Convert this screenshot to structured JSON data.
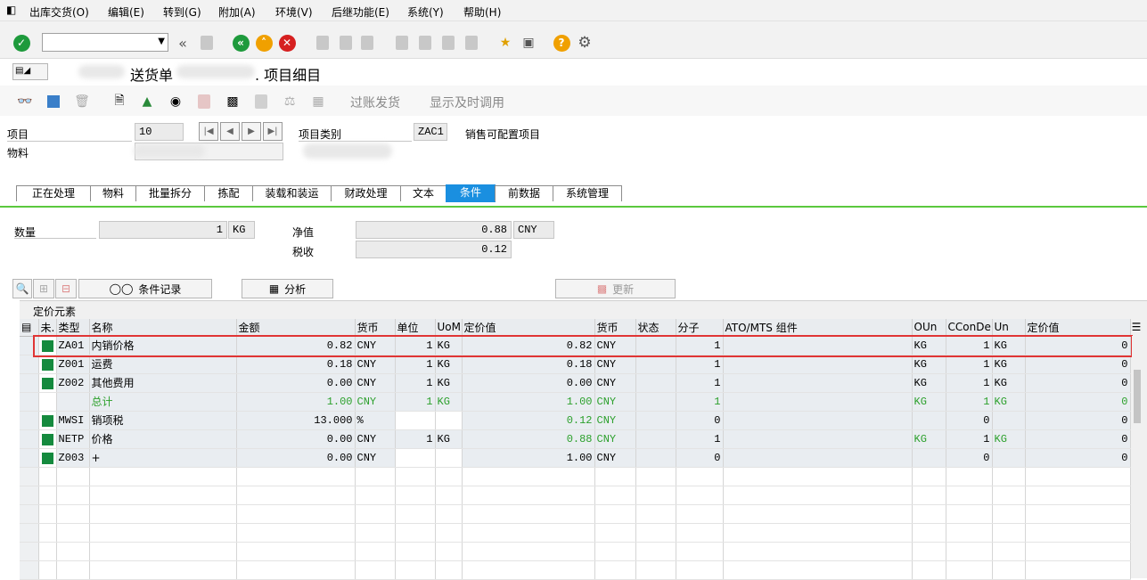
{
  "menu": [
    "出库交货(O)",
    "编辑(E)",
    "转到(G)",
    "附加(A)",
    "环境(V)",
    "后继功能(E)",
    "系统(Y)",
    "帮助(H)"
  ],
  "header": {
    "title_mid": "送货单",
    "title_end": ". 项目细目"
  },
  "apptoolbar": {
    "post_gi": "过账发货",
    "display_time": "显示及时调用"
  },
  "item": {
    "item_label": "项目",
    "item_value": "10",
    "material_label": "物料",
    "category_label": "项目类别",
    "category_value": "ZAC1",
    "category_desc": "销售可配置项目"
  },
  "tabs": [
    "正在处理",
    "物料",
    "批量拆分",
    "拣配",
    "装载和装运",
    "财政处理",
    "文本",
    "条件",
    "前数据",
    "系统管理"
  ],
  "active_tab": "条件",
  "summary": {
    "qty_label": "数量",
    "qty_value": "1",
    "qty_unit": "KG",
    "net_label": "净值",
    "net_value": "0.88",
    "net_curr": "CNY",
    "tax_label": "税收",
    "tax_value": "0.12"
  },
  "buttons": {
    "cond_record": "条件记录",
    "analysis": "分析",
    "update": "更新"
  },
  "pricing": {
    "section_title": "定价元素",
    "columns": [
      "未.",
      "类型",
      "名称",
      "金额",
      "货币",
      "单位",
      "UoM",
      "定价值",
      "货币",
      "状态",
      "分子",
      "ATO/MTS 组件",
      "OUn",
      "CConDe",
      "Un",
      "定价值"
    ],
    "rows": [
      {
        "type": "ZA01",
        "name": "内销价格",
        "amount": "0.82",
        "curr": "CNY",
        "unit": "1",
        "uom": "KG",
        "value": "0.82",
        "curr2": "CNY",
        "status": "",
        "num": "1",
        "ato": "",
        "oun": "KG",
        "ccon": "1",
        "un": "KG",
        "pv": "0",
        "green": false
      },
      {
        "type": "Z001",
        "name": "运费",
        "amount": "0.18",
        "curr": "CNY",
        "unit": "1",
        "uom": "KG",
        "value": "0.18",
        "curr2": "CNY",
        "status": "",
        "num": "1",
        "ato": "",
        "oun": "KG",
        "ccon": "1",
        "un": "KG",
        "pv": "0",
        "green": false
      },
      {
        "type": "Z002",
        "name": "其他费用",
        "amount": "0.00",
        "curr": "CNY",
        "unit": "1",
        "uom": "KG",
        "value": "0.00",
        "curr2": "CNY",
        "status": "",
        "num": "1",
        "ato": "",
        "oun": "KG",
        "ccon": "1",
        "un": "KG",
        "pv": "0",
        "green": false
      },
      {
        "type": "",
        "name": "总计",
        "amount": "1.00",
        "curr": "CNY",
        "unit": "1",
        "uom": "KG",
        "value": "1.00",
        "curr2": "CNY",
        "status": "",
        "num": "1",
        "ato": "",
        "oun": "KG",
        "ccon": "1",
        "un": "KG",
        "pv": "0",
        "green": true,
        "nosq": true
      },
      {
        "type": "MWSI",
        "name": "销项税",
        "amount": "13.000",
        "curr": "%",
        "unit": "",
        "uom": "",
        "value": "0.12",
        "curr2": "CNY",
        "status": "",
        "num": "0",
        "ato": "",
        "oun": "",
        "ccon": "0",
        "un": "",
        "pv": "0",
        "green": false,
        "greenval": true
      },
      {
        "type": "NETP",
        "name": "价格",
        "amount": "0.00",
        "curr": "CNY",
        "unit": "1",
        "uom": "KG",
        "value": "0.88",
        "curr2": "CNY",
        "status": "",
        "num": "1",
        "ato": "",
        "oun": "KG",
        "ccon": "1",
        "un": "KG",
        "pv": "0",
        "green": false,
        "greenval": true
      },
      {
        "type": "Z003",
        "name": "+",
        "amount": "0.00",
        "curr": "CNY",
        "unit": "",
        "uom": "",
        "value": "1.00",
        "curr2": "CNY",
        "status": "",
        "num": "0",
        "ato": "",
        "oun": "",
        "ccon": "0",
        "un": "",
        "pv": "0",
        "green": false
      }
    ]
  }
}
